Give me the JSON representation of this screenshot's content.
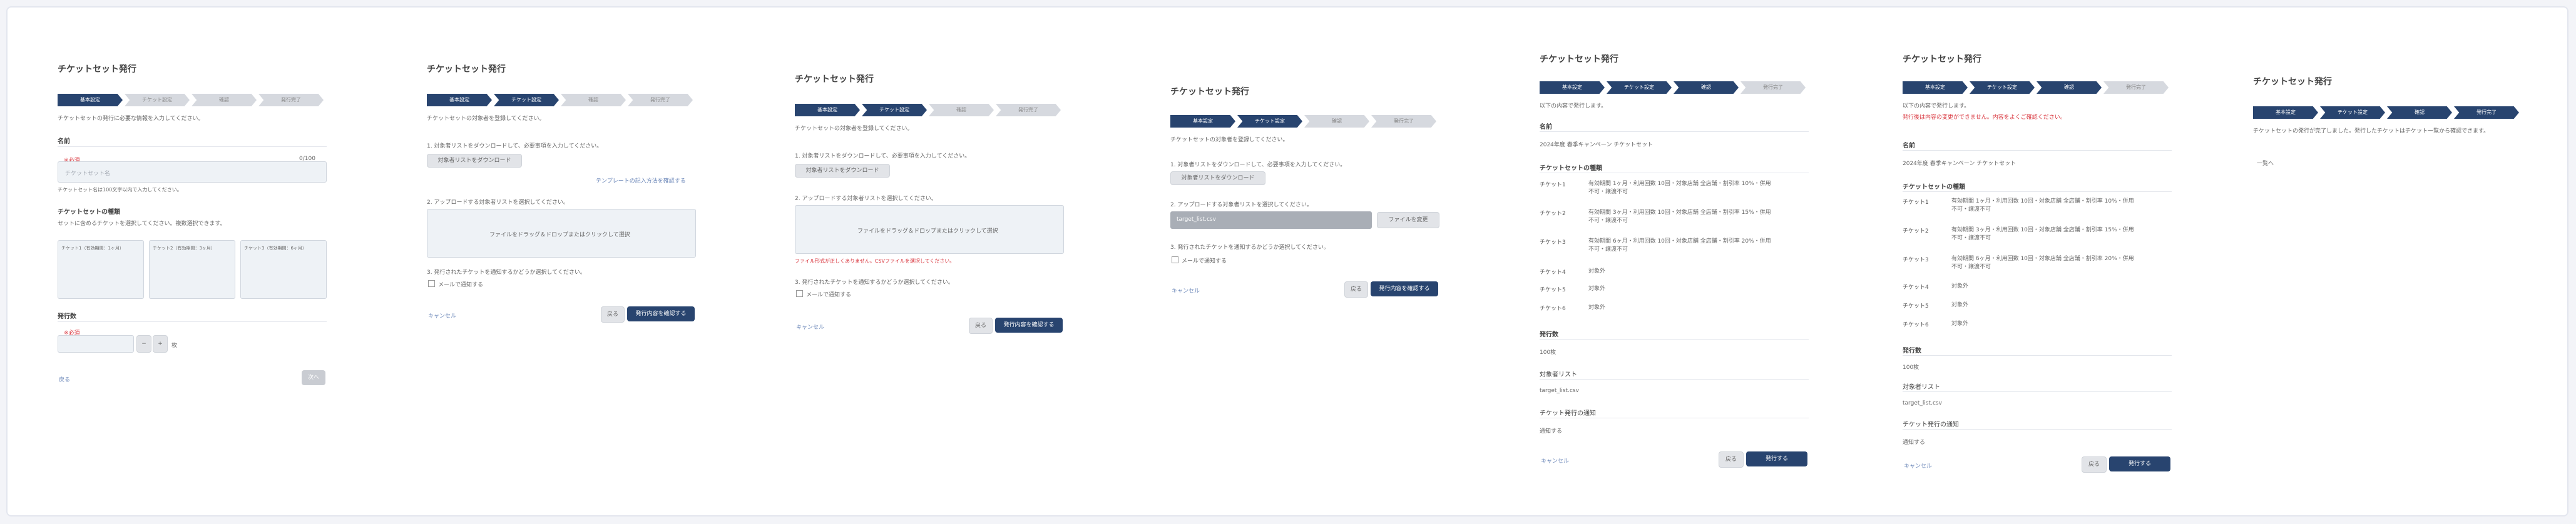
{
  "title": "チケットセット発行",
  "steps": [
    "基本設定",
    "チケット設定",
    "確認",
    "発行完了"
  ],
  "panel1": {
    "intro": "チケットセットの発行に必要な情報を入力してください。",
    "name_label": "名前",
    "required": "※必須",
    "name_placeholder": "チケットセット名",
    "name_count": "0/100",
    "name_hint": "チケットセット名は100文字以内で入力してください。",
    "tickets_label": "チケットセットの種類",
    "tickets_hint": "セットに含めるチケットを選択してください。複数選択できます。",
    "ticket_options": [
      "チケット1（有効期間：1ヶ月）",
      "チケット2（有効期間：3ヶ月）",
      "チケット3（有効期間：6ヶ月）"
    ],
    "qty_label": "発行数",
    "qty_unit": "枚",
    "back": "戻る",
    "next": "次へ"
  },
  "panel2": {
    "intro": "チケットセットの対象者を登録してください。",
    "step1": "1. 対象者リストをダウンロードして、必要事項を入力してください。",
    "download": "対象者リストをダウンロード",
    "template_link": "テンプレートの記入方法を確認する",
    "step2": "2. アップロードする対象者リストを選択してください。",
    "drop": "ファイルをドラッグ＆ドロップまたはクリックして選択",
    "step3": "3. 発行されたチケットを通知するかどうか選択してください。",
    "notify": "メールで通知する",
    "back": "戻る",
    "next": "発行内容を確認する",
    "cancel": "キャンセル"
  },
  "panel3": {
    "error": "ファイル形式が正しくありません。CSVファイルを選択してください。"
  },
  "panel4": {
    "file_name": "target_list.csv",
    "change": "ファイルを変更"
  },
  "confirm": {
    "intro": "以下の内容で発行します。",
    "warn": "発行後は内容の変更ができません。内容をよくご確認ください。",
    "name_label": "名前",
    "name_value": "2024年度 春季キャンペーン チケットセット",
    "tickets_label": "チケットセットの種類",
    "ticket_rows": [
      {
        "k": "チケット1",
        "v": "有効期間 1ヶ月・利用回数 10回・対象店舗 全店舗・割引率 10%・併用不可・譲渡不可"
      },
      {
        "k": "チケット2",
        "v": "有効期間 3ヶ月・利用回数 10回・対象店舗 全店舗・割引率 15%・併用不可・譲渡不可"
      },
      {
        "k": "チケット3",
        "v": "有効期間 6ヶ月・利用回数 10回・対象店舗 全店舗・割引率 20%・併用不可・譲渡不可"
      },
      {
        "k": "チケット4",
        "v": "対象外"
      },
      {
        "k": "チケット5",
        "v": "対象外"
      },
      {
        "k": "チケット6",
        "v": "対象外"
      }
    ],
    "qty_label": "発行数",
    "qty_value": "100枚",
    "list_label": "対象者リスト",
    "list_value": "target_list.csv",
    "notify_label": "チケット発行の通知",
    "notify_value": "通知する",
    "cancel": "キャンセル",
    "back": "戻る",
    "issue": "発行する"
  },
  "done": {
    "message": "チケットセットの発行が完了しました。発行したチケットはチケット一覧から確認できます。",
    "link": "一覧へ"
  },
  "colors": {
    "accent": "#28446f",
    "error": "#d9363e",
    "link": "#6a86b8"
  }
}
